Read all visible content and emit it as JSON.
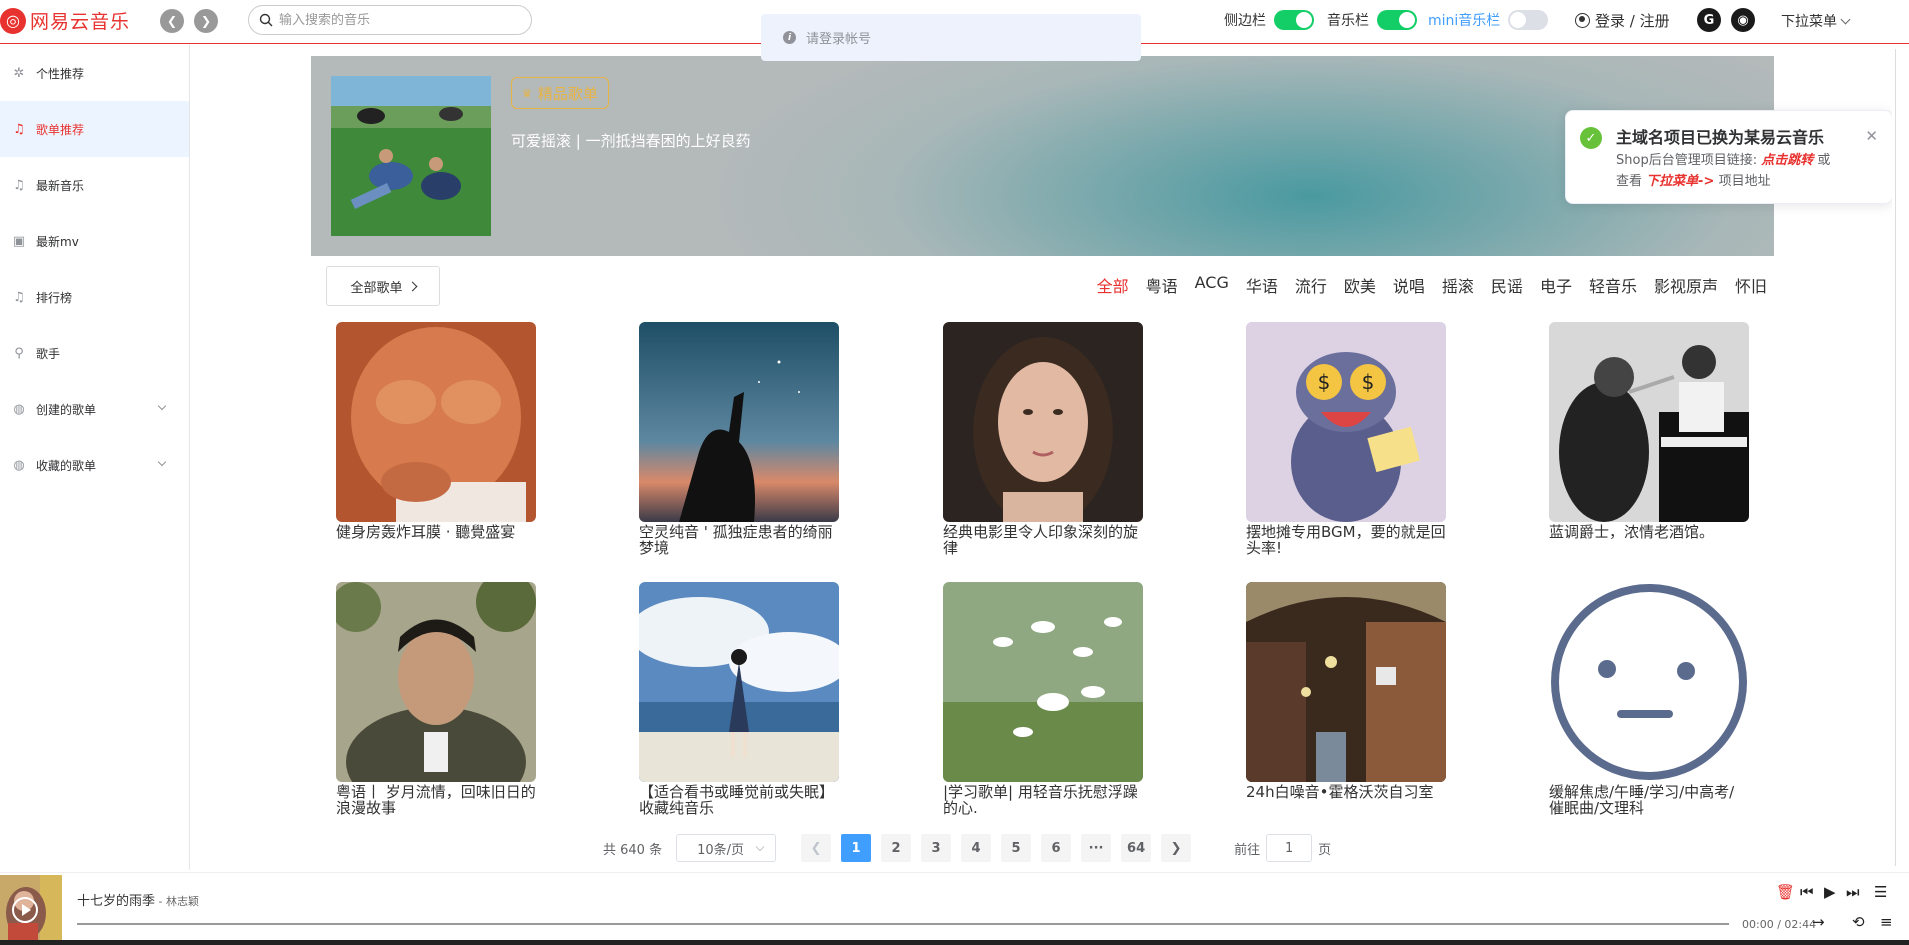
{
  "header": {
    "logo_text": "网易云音乐",
    "search_placeholder": "输入搜索的音乐",
    "login_tip": "请登录帐号",
    "toggles": [
      {
        "label": "侧边栏",
        "on": true
      },
      {
        "label": "音乐栏",
        "on": true
      },
      {
        "label": "mini音乐栏",
        "on": false
      }
    ],
    "login_label": "登录 / 注册",
    "gitee_glyph": "G",
    "github_glyph": "◉",
    "dropdown_label": "下拉菜单"
  },
  "sidebar": {
    "items": [
      {
        "label": "个性推荐",
        "icon": "compass-icon",
        "active": false
      },
      {
        "label": "歌单推荐",
        "icon": "music-note-icon",
        "active": true
      },
      {
        "label": "最新音乐",
        "icon": "music-note-icon",
        "active": false
      },
      {
        "label": "最新mv",
        "icon": "video-icon",
        "active": false
      },
      {
        "label": "排行榜",
        "icon": "music-note-icon",
        "active": false
      },
      {
        "label": "歌手",
        "icon": "user-icon",
        "active": false
      },
      {
        "label": "创建的歌单",
        "icon": "disc-icon",
        "active": false,
        "expandable": true
      },
      {
        "label": "收藏的歌单",
        "icon": "disc-icon",
        "active": false,
        "expandable": true
      }
    ]
  },
  "banner": {
    "tag": "精品歌单",
    "title": "可爱摇滚 | 一剂抵挡春困的上好良药"
  },
  "categories": {
    "all_button": "全部歌单",
    "tags": [
      "全部",
      "粤语",
      "ACG",
      "华语",
      "流行",
      "欧美",
      "说唱",
      "摇滚",
      "民谣",
      "电子",
      "轻音乐",
      "影视原声",
      "怀旧"
    ],
    "active_index": 0
  },
  "playlists": [
    {
      "title": "健身房轰炸耳膜 · 聽覺盛宴"
    },
    {
      "title": "空灵纯音 ' 孤独症患者的绮丽梦境"
    },
    {
      "title": "经典电影里令人印象深刻的旋律"
    },
    {
      "title": "摆地摊专用BGM，要的就是回头率!"
    },
    {
      "title": "蓝调爵士，浓情老酒馆。"
    },
    {
      "title": "粤语丨 岁月流情，回味旧日的浪漫故事"
    },
    {
      "title": "【适合看书或睡觉前或失眠】收藏纯音乐"
    },
    {
      "title": "|学习歌单| 用轻音乐抚慰浮躁的心."
    },
    {
      "title": "24h白噪音•霍格沃茨自习室"
    },
    {
      "title": "缓解焦虑/午睡/学习/中高考/催眠曲/文理科"
    }
  ],
  "pagination": {
    "total": "共 640 条",
    "page_size": "10条/页",
    "pages": [
      "1",
      "2",
      "3",
      "4",
      "5",
      "6",
      "···",
      "64"
    ],
    "current": "1",
    "jump_prefix": "前往",
    "jump_value": "1",
    "jump_suffix": "页"
  },
  "notification": {
    "title": "主域名项目已换为某易云音乐",
    "line1_prefix": "Shop后台管理项目链接: ",
    "line1_link": "点击跳转",
    "line1_suffix": " 或",
    "line2_prefix": "查看 ",
    "line2_link": "下拉菜单->",
    "line2_suffix": " 项目地址"
  },
  "player": {
    "song": "十七岁的雨季",
    "artist": " - 林志颖",
    "time": "00:00 / 02:44"
  }
}
